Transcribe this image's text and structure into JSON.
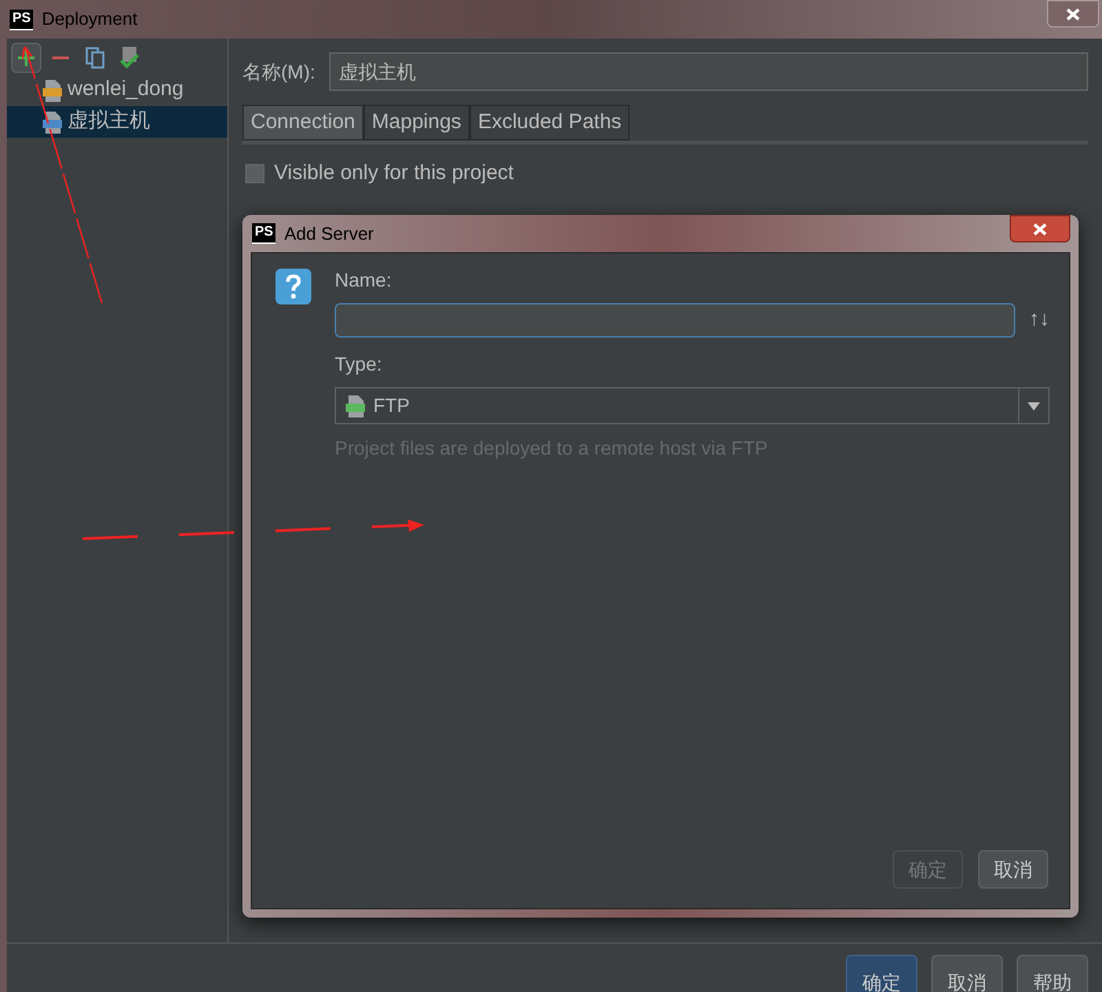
{
  "window": {
    "title": "Deployment",
    "logo": "PS"
  },
  "toolbar": [
    {
      "kind": "add"
    },
    {
      "kind": "remove"
    },
    {
      "kind": "copy"
    },
    {
      "kind": "check"
    }
  ],
  "servers": [
    {
      "name": "wenlei_dong",
      "kind": "sftp",
      "selected": false
    },
    {
      "name": "虚拟主机",
      "kind": "ftps",
      "selected": true
    }
  ],
  "name_label": "名称(M):",
  "name_value": "虚拟主机",
  "tabs": [
    {
      "label": "Connection",
      "selected": true
    },
    {
      "label": "Mappings",
      "selected": false
    },
    {
      "label": "Excluded Paths",
      "selected": false
    }
  ],
  "visible_only": {
    "label": "Visible only for this project",
    "checked": false
  },
  "dialog": {
    "title": "Add Server",
    "logo": "PS",
    "name_label": "Name:",
    "sort_glyph": "↑↓",
    "type_label": "Type:",
    "type_value": "FTP",
    "description": "Project files are deployed to a remote host via FTP",
    "buttons": [
      {
        "label": "确定",
        "disabled": true
      },
      {
        "label": "取消",
        "disabled": false
      }
    ]
  },
  "buttons": [
    {
      "label": "确定",
      "primary": true
    },
    {
      "label": "取消",
      "primary": false
    },
    {
      "label": "帮助",
      "primary": false
    }
  ]
}
